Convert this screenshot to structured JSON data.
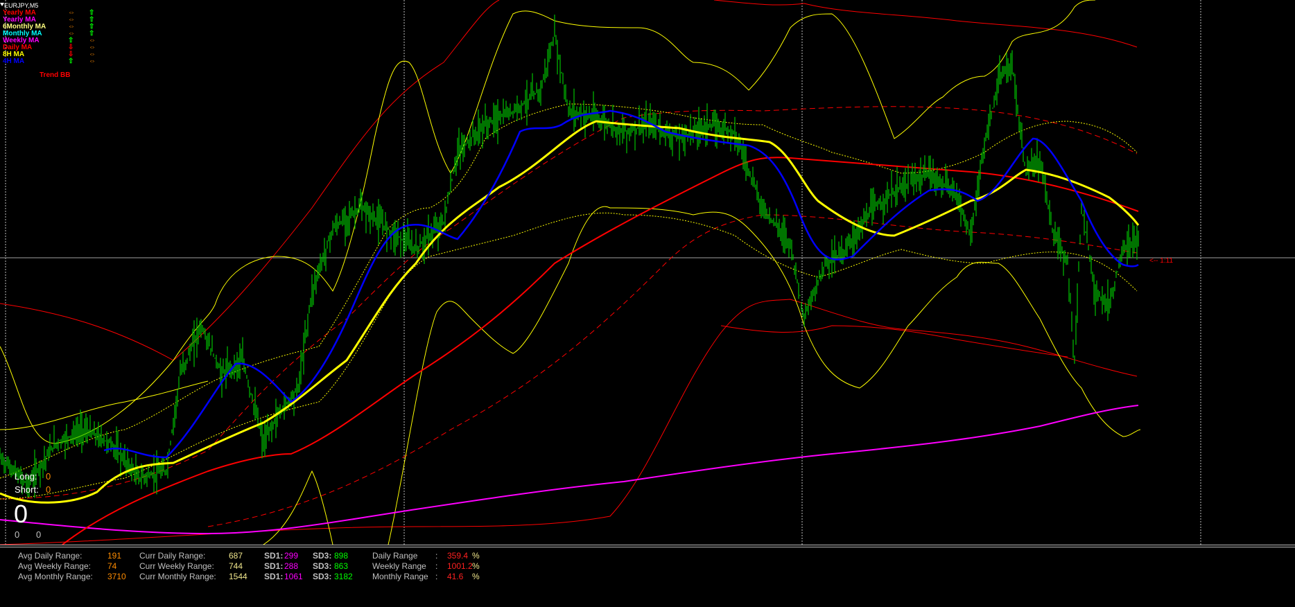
{
  "chart": {
    "symbol": "EURJPY,M5",
    "price_marker": "<-- 1:11",
    "colors": {
      "background": "#000000",
      "candles": "#00c000",
      "yearly_ma": "#ff00ff",
      "daily_ma": "#ff0000",
      "h8_ma": "#ffff00",
      "h4_ma": "#0000ff",
      "bands_yellow": "#ffff00",
      "bands_red": "#ff0000",
      "grid": "#c0c0c0"
    }
  },
  "legend": {
    "items": [
      {
        "label": "Yearly MA",
        "color": "#ff0000",
        "icon1": "⇔",
        "icon1_color": "#ff8c00",
        "icon2": "⇧",
        "icon2_color": "#00ff00"
      },
      {
        "label": "Yearly MA",
        "color": "#ff00ff",
        "icon1": "⇔",
        "icon1_color": "#ff8c00",
        "icon2": "⇧",
        "icon2_color": "#00ff00"
      },
      {
        "label": "6Monthly MA",
        "color": "#ffff80",
        "icon1": "⇔",
        "icon1_color": "#ff8c00",
        "icon2": "⇧",
        "icon2_color": "#00ff00"
      },
      {
        "label": "Monthly MA",
        "color": "#00ffff",
        "icon1": "⇔",
        "icon1_color": "#ff8c00",
        "icon2": "⇧",
        "icon2_color": "#00ff00"
      },
      {
        "label": "Weekly MA",
        "color": "#ff00ff",
        "icon1": "⇧",
        "icon1_color": "#00ff00",
        "icon2": "⇔",
        "icon2_color": "#ff8c00"
      },
      {
        "label": "Daily MA",
        "color": "#ff0000",
        "icon1": "⇩",
        "icon1_color": "#ff0000",
        "icon2": "⇔",
        "icon2_color": "#ff8c00"
      },
      {
        "label": "8H MA",
        "color": "#ffff00",
        "icon1": "⇩",
        "icon1_color": "#ff0000",
        "icon2": "⇔",
        "icon2_color": "#ff8c00"
      },
      {
        "label": "4H MA",
        "color": "#0000ff",
        "icon1": "⇧",
        "icon1_color": "#00ff00",
        "icon2": "⇔",
        "icon2_color": "#ff8c00"
      }
    ],
    "trend_bb": "Trend BB"
  },
  "positions": {
    "long_label": "Long:",
    "long_value": "0",
    "short_label": "Short:",
    "short_value": "0",
    "big_value": "0",
    "left_small": "0",
    "right_small": "0"
  },
  "stats": {
    "avg_daily_label": "Avg Daily Range:",
    "avg_daily_value": "191",
    "avg_weekly_label": "Avg Weekly Range:",
    "avg_weekly_value": "74",
    "avg_monthly_label": "Avg Monthly Range:",
    "avg_monthly_value": "3710",
    "curr_daily_label": "Curr Daily Range:",
    "curr_daily_value": "687",
    "curr_weekly_label": "Curr Weekly Range:",
    "curr_weekly_value": "744",
    "curr_monthly_label": "Curr Monthly Range:",
    "curr_monthly_value": "1544",
    "sd1_label": "SD1:",
    "sd1_daily": "299",
    "sd1_weekly": "288",
    "sd1_monthly": "1061",
    "sd3_label": "SD3:",
    "sd3_daily": "898",
    "sd3_weekly": "863",
    "sd3_monthly": "3182",
    "daily_range_label": "Daily Range",
    "weekly_range_label": "Weekly Range",
    "monthly_range_label": "Monthly Range",
    "colon": ":",
    "daily_pct": "359.4",
    "weekly_pct": "1001.2",
    "monthly_pct": "41.6",
    "pct_sign": "%"
  }
}
